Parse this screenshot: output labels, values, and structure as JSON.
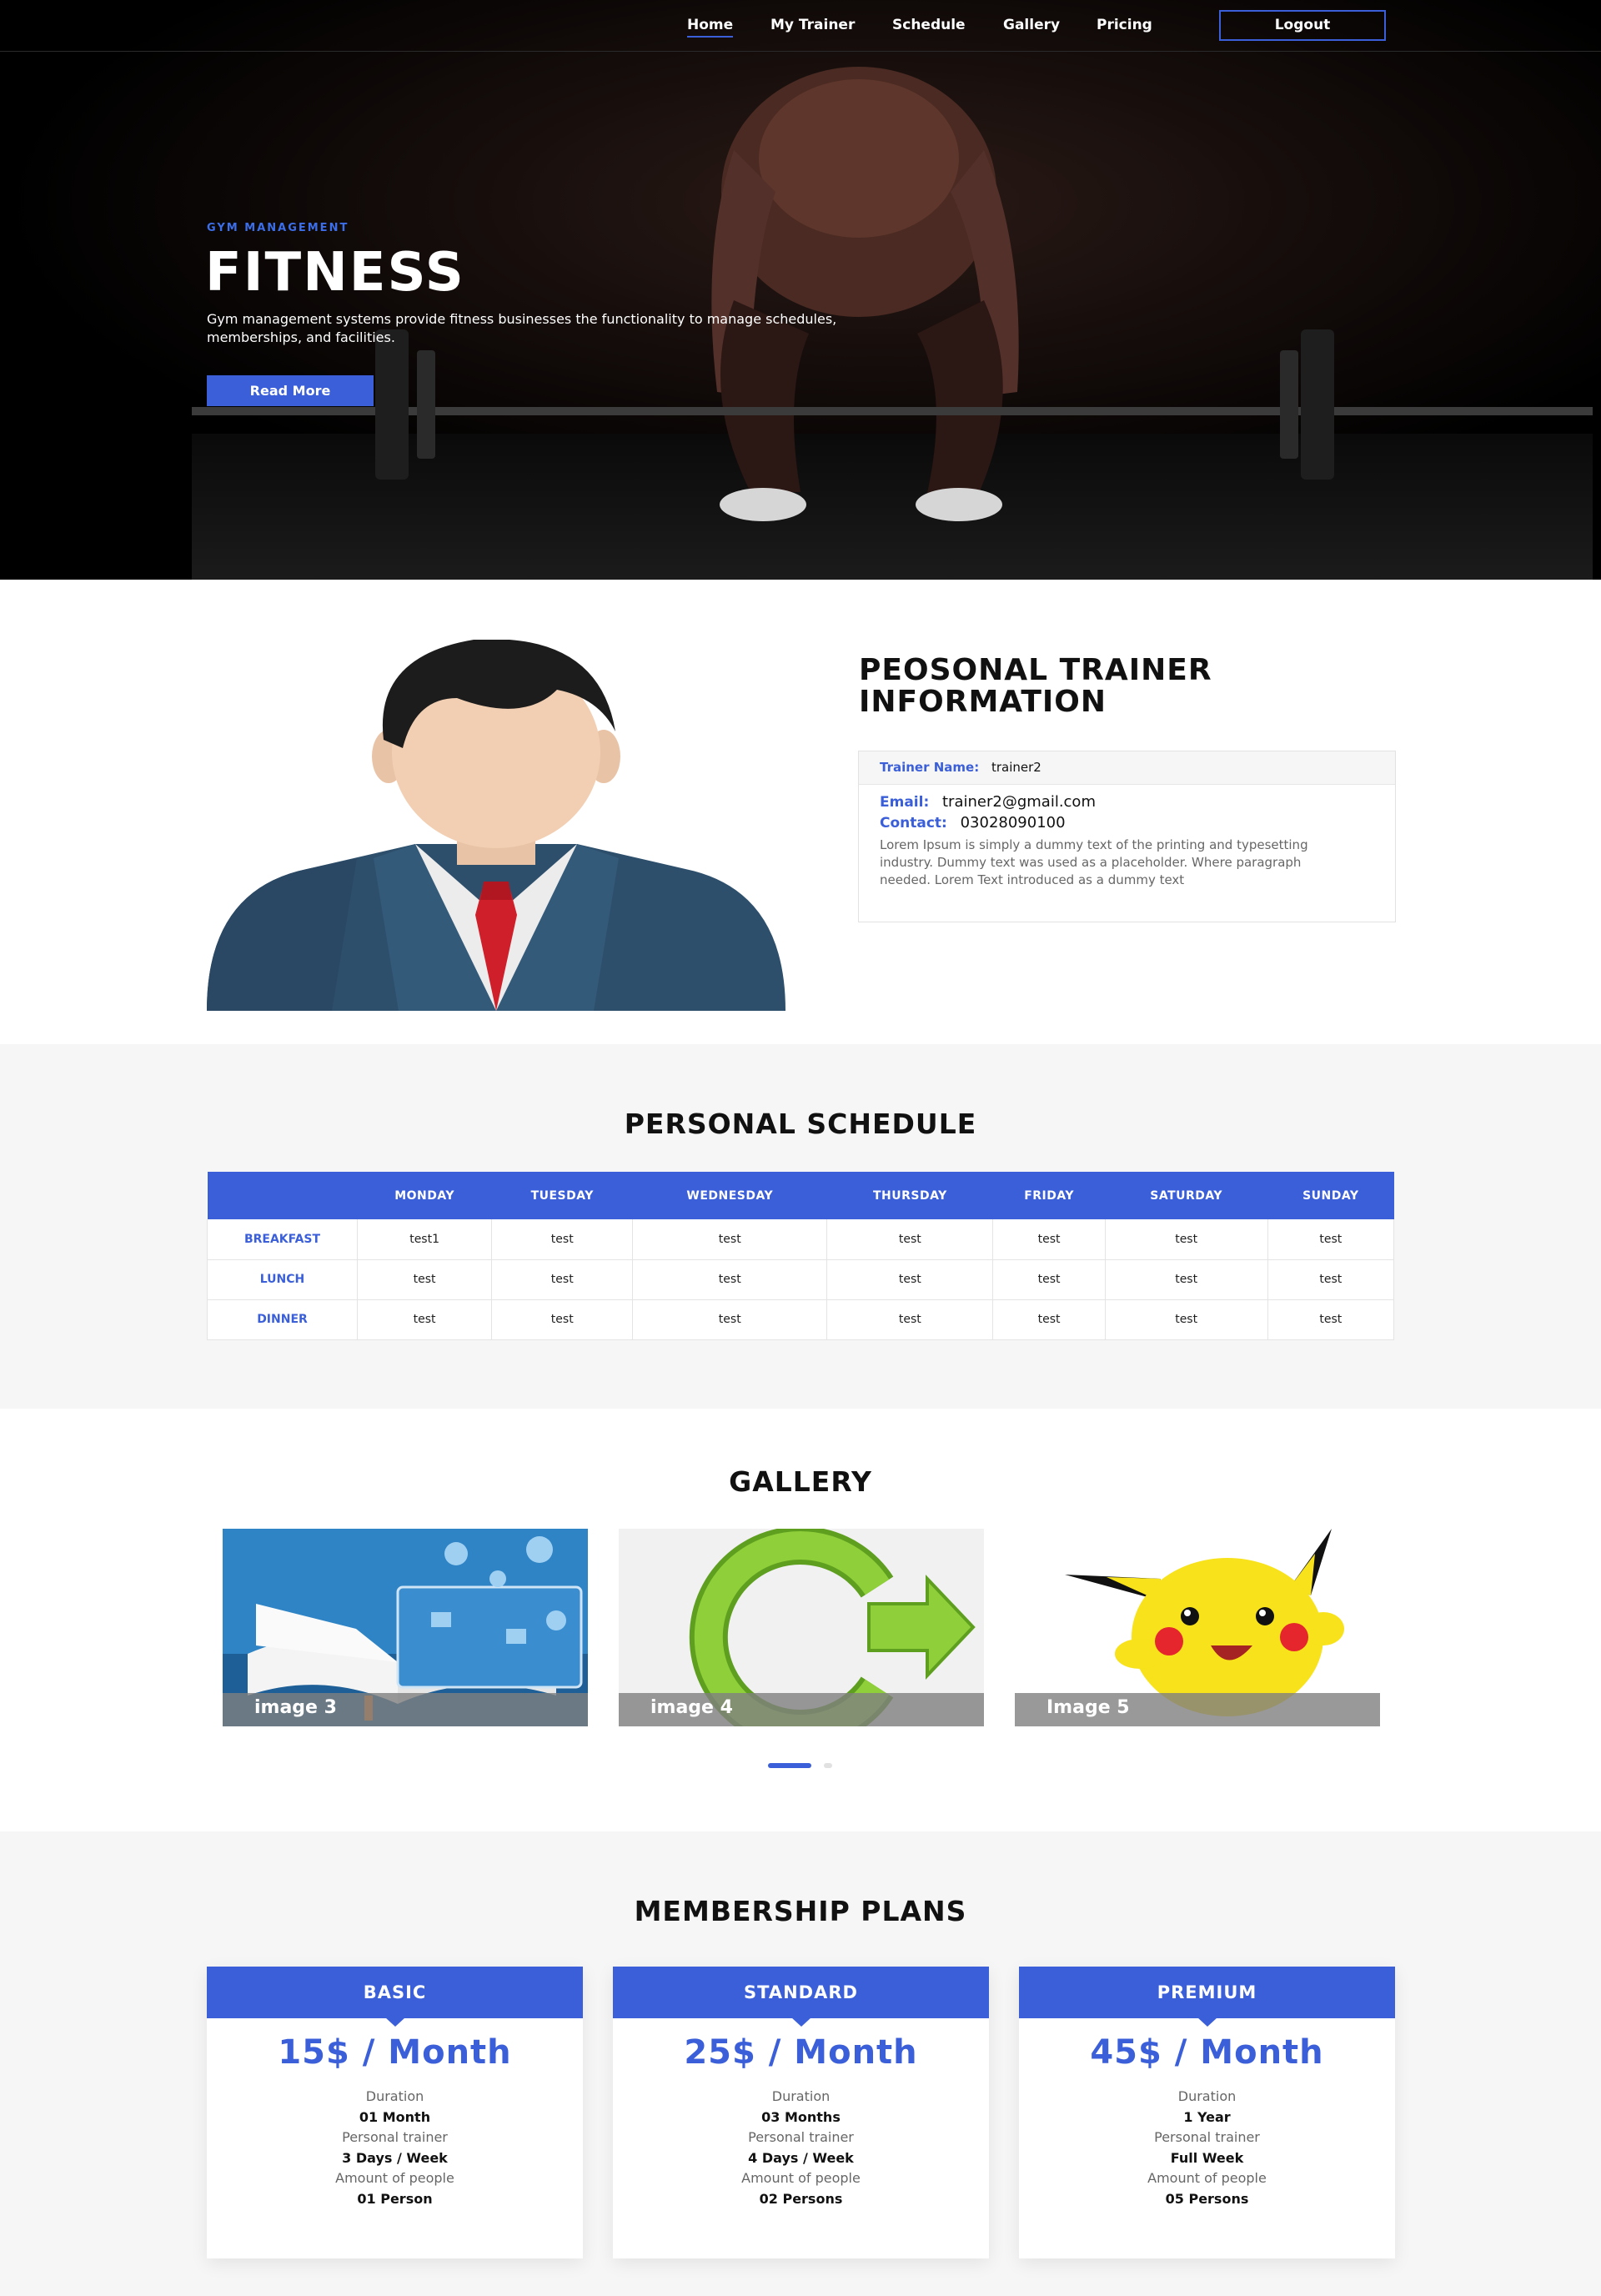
{
  "nav": {
    "items": [
      "Home",
      "My Trainer",
      "Schedule",
      "Gallery",
      "Pricing"
    ],
    "logout_label": "Logout"
  },
  "hero": {
    "kicker": "GYM MANAGEMENT",
    "title": "FITNESS",
    "text": "Gym management systems provide fitness businesses the functionality to manage schedules, memberships, and facilities.",
    "button_label": "Read More"
  },
  "trainer": {
    "heading_line1": "PEOSONAL TRAINER",
    "heading_line2": "INFORMATION",
    "name_label": "Trainer Name:",
    "name": "trainer2",
    "email_label": "Email:",
    "email": "trainer2@gmail.com",
    "contact_label": "Contact:",
    "contact": "03028090100",
    "description": "Lorem Ipsum is simply a dummy text of the printing and typesetting industry. Dummy text was used as a placeholder. Where paragraph needed. Lorem Text introduced as a dummy text"
  },
  "schedule": {
    "title": "PERSONAL SCHEDULE",
    "days": [
      "MONDAY",
      "TUESDAY",
      "WEDNESDAY",
      "THURSDAY",
      "FRIDAY",
      "SATURDAY",
      "SUNDAY"
    ],
    "rows": [
      {
        "meal": "BREAKFAST",
        "cells": [
          "test1",
          "test",
          "test",
          "test",
          "test",
          "test",
          "test"
        ]
      },
      {
        "meal": "LUNCH",
        "cells": [
          "test",
          "test",
          "test",
          "test",
          "test",
          "test",
          "test"
        ]
      },
      {
        "meal": "DINNER",
        "cells": [
          "test",
          "test",
          "test",
          "test",
          "test",
          "test",
          "test"
        ]
      }
    ]
  },
  "gallery": {
    "title": "GALLERY",
    "items": [
      {
        "caption": "image 3"
      },
      {
        "caption": "image 4"
      },
      {
        "caption": "Image 5"
      }
    ],
    "active_slide_index": 0
  },
  "plans": {
    "title": "MEMBERSHIP PLANS",
    "duration_label": "Duration",
    "trainer_label": "Personal trainer",
    "people_label": "Amount of people",
    "items": [
      {
        "name": "BASIC",
        "price": "15$ / Month",
        "duration": "01 Month",
        "trainer": "3 Days / Week",
        "people": "01 Person"
      },
      {
        "name": "STANDARD",
        "price": "25$ / Month",
        "duration": "03 Months",
        "trainer": "4 Days / Week",
        "people": "02 Persons"
      },
      {
        "name": "PREMIUM",
        "price": "45$ / Month",
        "duration": "1 Year",
        "trainer": "Full Week",
        "people": "05 Persons"
      }
    ]
  },
  "colors": {
    "accent": "#3b5fd8",
    "hero_bg": "#000000",
    "section_alt_bg": "#f6f6f6"
  }
}
